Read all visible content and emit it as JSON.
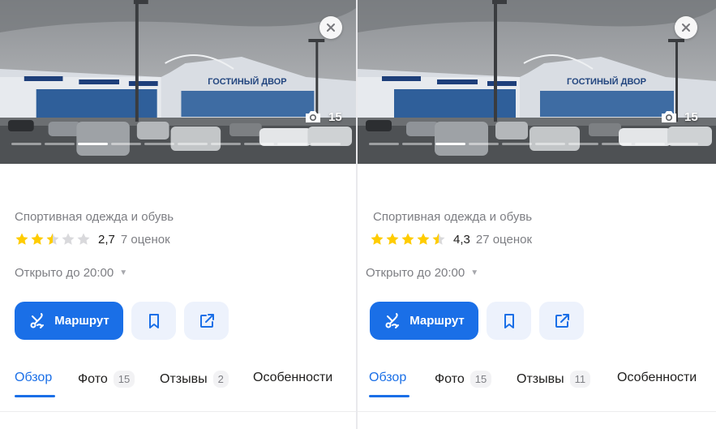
{
  "cards": [
    {
      "photos_count": "15",
      "category": "Спортивная одежда и обувь",
      "rating_value": "2,7",
      "reviews_count": "7 оценок",
      "stars": [
        1,
        1,
        0.5,
        0,
        0
      ],
      "hours": "Открыто до 20:00",
      "route_label": "Маршрут",
      "tabs": [
        {
          "label": "Обзор",
          "badge": ""
        },
        {
          "label": "Фото",
          "badge": "15"
        },
        {
          "label": "Отзывы",
          "badge": "2"
        },
        {
          "label": "Особенности",
          "badge": ""
        }
      ],
      "building_sign": "ГОСТИНЫЙ ДВОР"
    },
    {
      "photos_count": "15",
      "category": "Спортивная одежда и обувь",
      "rating_value": "4,3",
      "reviews_count": "27 оценок",
      "stars": [
        1,
        1,
        1,
        1,
        0.5
      ],
      "hours": "Открыто до 20:00",
      "route_label": "Маршрут",
      "tabs": [
        {
          "label": "Обзор",
          "badge": ""
        },
        {
          "label": "Фото",
          "badge": "15"
        },
        {
          "label": "Отзывы",
          "badge": "11"
        },
        {
          "label": "Особенности",
          "badge": ""
        }
      ],
      "building_sign": "ГОСТИНЫЙ ДВОР"
    }
  ],
  "icons": {
    "close": "close-icon",
    "camera": "camera-icon",
    "route": "route-icon",
    "bookmark": "bookmark-icon",
    "share": "share-icon",
    "star": "star-icon"
  },
  "colors": {
    "accent": "#1a6fe7",
    "star_filled": "#fc0",
    "star_empty": "#d9d9dc",
    "secondary_text": "#7d7e83"
  },
  "active_photo_index": 2,
  "active_tab_index": 0
}
